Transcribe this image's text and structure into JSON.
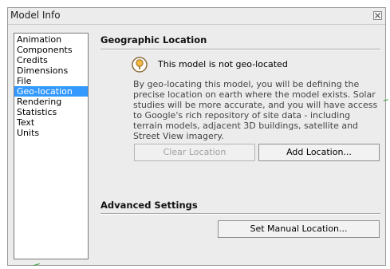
{
  "window": {
    "title": "Model Info"
  },
  "sidebar": {
    "items": [
      {
        "label": "Animation"
      },
      {
        "label": "Components"
      },
      {
        "label": "Credits"
      },
      {
        "label": "Dimensions"
      },
      {
        "label": "File"
      },
      {
        "label": "Geo-location",
        "selected": true
      },
      {
        "label": "Rendering"
      },
      {
        "label": "Statistics"
      },
      {
        "label": "Text"
      },
      {
        "label": "Units"
      }
    ]
  },
  "geo": {
    "section_title": "Geographic Location",
    "status_icon": "location-pin-icon",
    "status_text": "This model is not geo-located",
    "description": "By geo-locating this model, you will be defining the precise location on earth where the model exists. Solar studies will be more accurate, and you will have access to Google's rich repository of site data - including terrain models, adjacent 3D buildings, satellite and Street View imagery.",
    "clear_label": "Clear Location",
    "add_label": "Add Location..."
  },
  "advanced": {
    "section_title": "Advanced Settings",
    "manual_label": "Set Manual Location..."
  },
  "colors": {
    "selection": "#3399ff",
    "dialog_bg": "#ececec",
    "pin_fill": "#f4b942"
  }
}
